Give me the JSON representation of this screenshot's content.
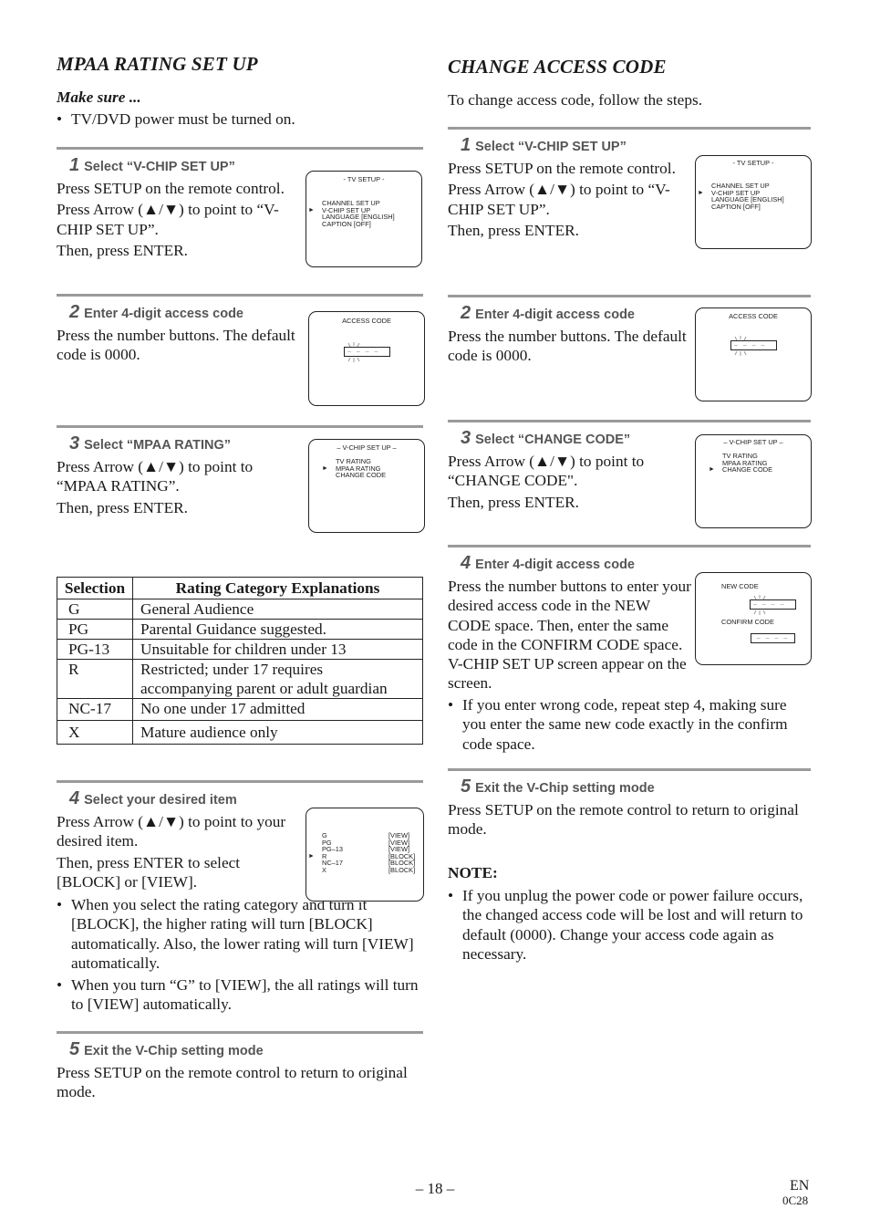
{
  "left": {
    "title": "MPAA RATING SET UP",
    "make_sure": "Make sure ...",
    "make_sure_bullet": "TV/DVD power must be turned on.",
    "steps": [
      {
        "num": "1",
        "heading": "Select “V-CHIP SET UP”",
        "lines": [
          "Press SETUP on the remote control.",
          "Press Arrow (▲/▼) to point to “V-CHIP SET UP”.",
          "Then, press ENTER."
        ],
        "screen": {
          "title": "- TV SETUP -",
          "items": [
            "CHANNEL SET UP",
            "V-CHIP SET UP",
            "LANGUAGE  [ENGLISH]",
            "CAPTION  [OFF]"
          ],
          "pointer_index": 1,
          "pointer": "►"
        }
      },
      {
        "num": "2",
        "heading": "Enter 4-digit access code",
        "lines": [
          "Press the number buttons. The default code is 0000."
        ],
        "screen": {
          "title": "ACCESS CODE",
          "code": "– – – –"
        }
      },
      {
        "num": "3",
        "heading": "Select “MPAA RATING”",
        "lines": [
          "Press Arrow (▲/▼) to point to “MPAA RATING”.",
          "Then, press ENTER."
        ],
        "screen": {
          "title": "– V-CHIP SET UP –",
          "items": [
            "TV RATING",
            "MPAA RATING",
            "CHANGE CODE"
          ],
          "pointer_index": 1,
          "pointer": "►"
        }
      },
      {
        "num": "4",
        "heading": "Select your desired item",
        "lines": [
          "Press Arrow (▲/▼) to point to your desired item.",
          "Then, press ENTER to select [BLOCK] or [VIEW]."
        ],
        "bullets": [
          "When you select the rating category and turn it [BLOCK], the higher rating will turn [BLOCK] automatically. Also, the lower rating will turn [VIEW] automatically.",
          "When you turn “G” to [VIEW], the all ratings will turn to [VIEW] automatically."
        ],
        "screen": {
          "rows": [
            {
              "rating": "G",
              "state": "[VIEW]"
            },
            {
              "rating": "PG",
              "state": "[VIEW]"
            },
            {
              "rating": "PG–13",
              "state": "[VIEW]"
            },
            {
              "rating": "R",
              "state": "[BLOCK]"
            },
            {
              "rating": "NC–17",
              "state": "[BLOCK]"
            },
            {
              "rating": "X",
              "state": "[BLOCK]"
            }
          ],
          "pointer_index": 3,
          "pointer": "►"
        }
      },
      {
        "num": "5",
        "heading": "Exit the V-Chip setting mode",
        "lines": [
          "Press SETUP on the remote control to return to original mode."
        ]
      }
    ],
    "table": {
      "headers": [
        "Selection",
        "Rating Category Explanations"
      ],
      "rows": [
        [
          "G",
          "General Audience"
        ],
        [
          "PG",
          "Parental Guidance suggested."
        ],
        [
          "PG-13",
          "Unsuitable for children under 13"
        ],
        [
          "R",
          "Restricted; under 17 requires accompanying parent or adult guardian"
        ],
        [
          "NC-17",
          "No one under 17 admitted"
        ],
        [
          "X",
          "Mature audience only"
        ]
      ]
    }
  },
  "right": {
    "title": "CHANGE ACCESS CODE",
    "intro": "To change access code, follow the steps.",
    "steps": [
      {
        "num": "1",
        "heading": "Select “V-CHIP SET UP”",
        "lines": [
          "Press SETUP on the remote control.",
          "Press Arrow (▲/▼) to point to “V-CHIP SET UP”.",
          "Then, press ENTER."
        ],
        "screen": {
          "title": "- TV SETUP -",
          "items": [
            "CHANNEL SET UP",
            "V-CHIP SET UP",
            "LANGUAGE  [ENGLISH]",
            "CAPTION  [OFF]"
          ],
          "pointer_index": 1,
          "pointer": "►"
        }
      },
      {
        "num": "2",
        "heading": "Enter 4-digit access code",
        "lines": [
          "Press the number buttons. The default code is 0000."
        ],
        "screen": {
          "title": "ACCESS CODE",
          "code": "– – – –"
        }
      },
      {
        "num": "3",
        "heading": "Select “CHANGE CODE”",
        "lines": [
          "Press Arrow (▲/▼) to point to “CHANGE CODE\".",
          "Then, press ENTER."
        ],
        "screen": {
          "title": "– V-CHIP SET UP –",
          "items": [
            "TV RATING",
            "MPAA RATING",
            "CHANGE CODE"
          ],
          "pointer_index": 2,
          "pointer": "►"
        }
      },
      {
        "num": "4",
        "heading": "Enter 4-digit access code",
        "lines": [
          "Press the number buttons to enter your desired access code in the NEW CODE space. Then, enter the same code in the CONFIRM CODE space. V-CHIP SET UP screen appear on the screen."
        ],
        "bullets": [
          "If you enter wrong code, repeat step 4, making sure you enter the same new code exactly in the confirm code space."
        ],
        "screen": {
          "new_label": "NEW CODE",
          "confirm_label": "CONFIRM CODE",
          "new_code": "– – – –",
          "confirm_code": "– – – –"
        }
      },
      {
        "num": "5",
        "heading": "Exit the V-Chip setting mode",
        "lines": [
          "Press SETUP on the remote control to return to original mode."
        ]
      }
    ],
    "note_title": "NOTE:",
    "note_bullets": [
      "If you unplug the power code or power failure occurs, the changed access code will be lost and will return to default (0000). Change your access code again as necessary."
    ]
  },
  "footer": {
    "page": "– 18 –",
    "lang": "EN",
    "code": "0C28"
  }
}
